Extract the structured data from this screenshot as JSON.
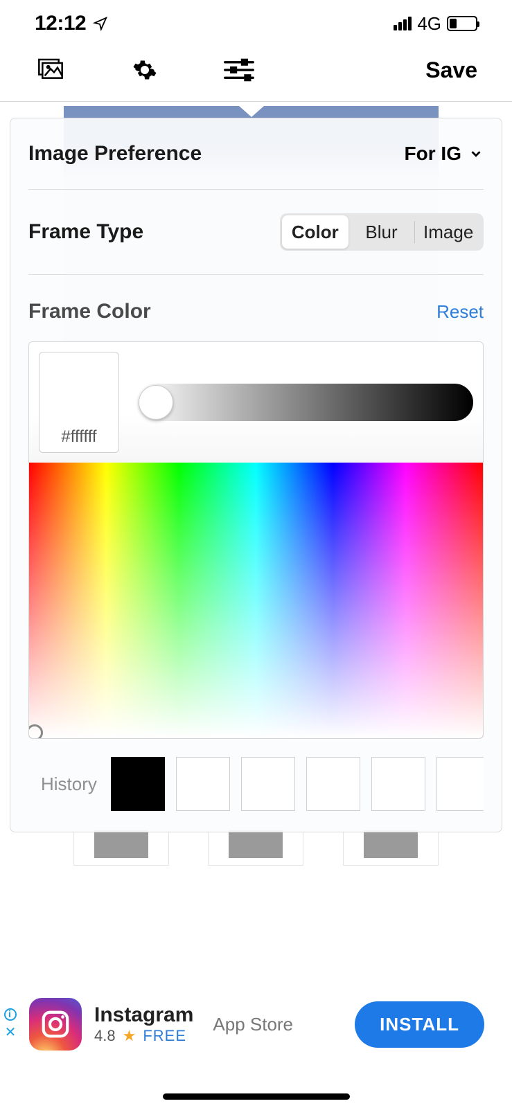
{
  "status": {
    "time": "12:12",
    "network": "4G"
  },
  "toolbar": {
    "save": "Save"
  },
  "prefs": {
    "image_pref_label": "Image Preference",
    "image_pref_value": "For IG",
    "frame_type_label": "Frame Type",
    "frame_type_options": {
      "color": "Color",
      "blur": "Blur",
      "image": "Image"
    },
    "frame_color_label": "Frame Color",
    "reset": "Reset",
    "hex": "#ffffff",
    "history_label": "History",
    "history": [
      "#000000",
      "#ffffff",
      "#ffffff",
      "#ffffff",
      "#ffffff",
      "#ffffff"
    ]
  },
  "ad": {
    "title": "Instagram",
    "rating": "4.8",
    "free": "FREE",
    "store": "App Store",
    "cta": "INSTALL"
  }
}
